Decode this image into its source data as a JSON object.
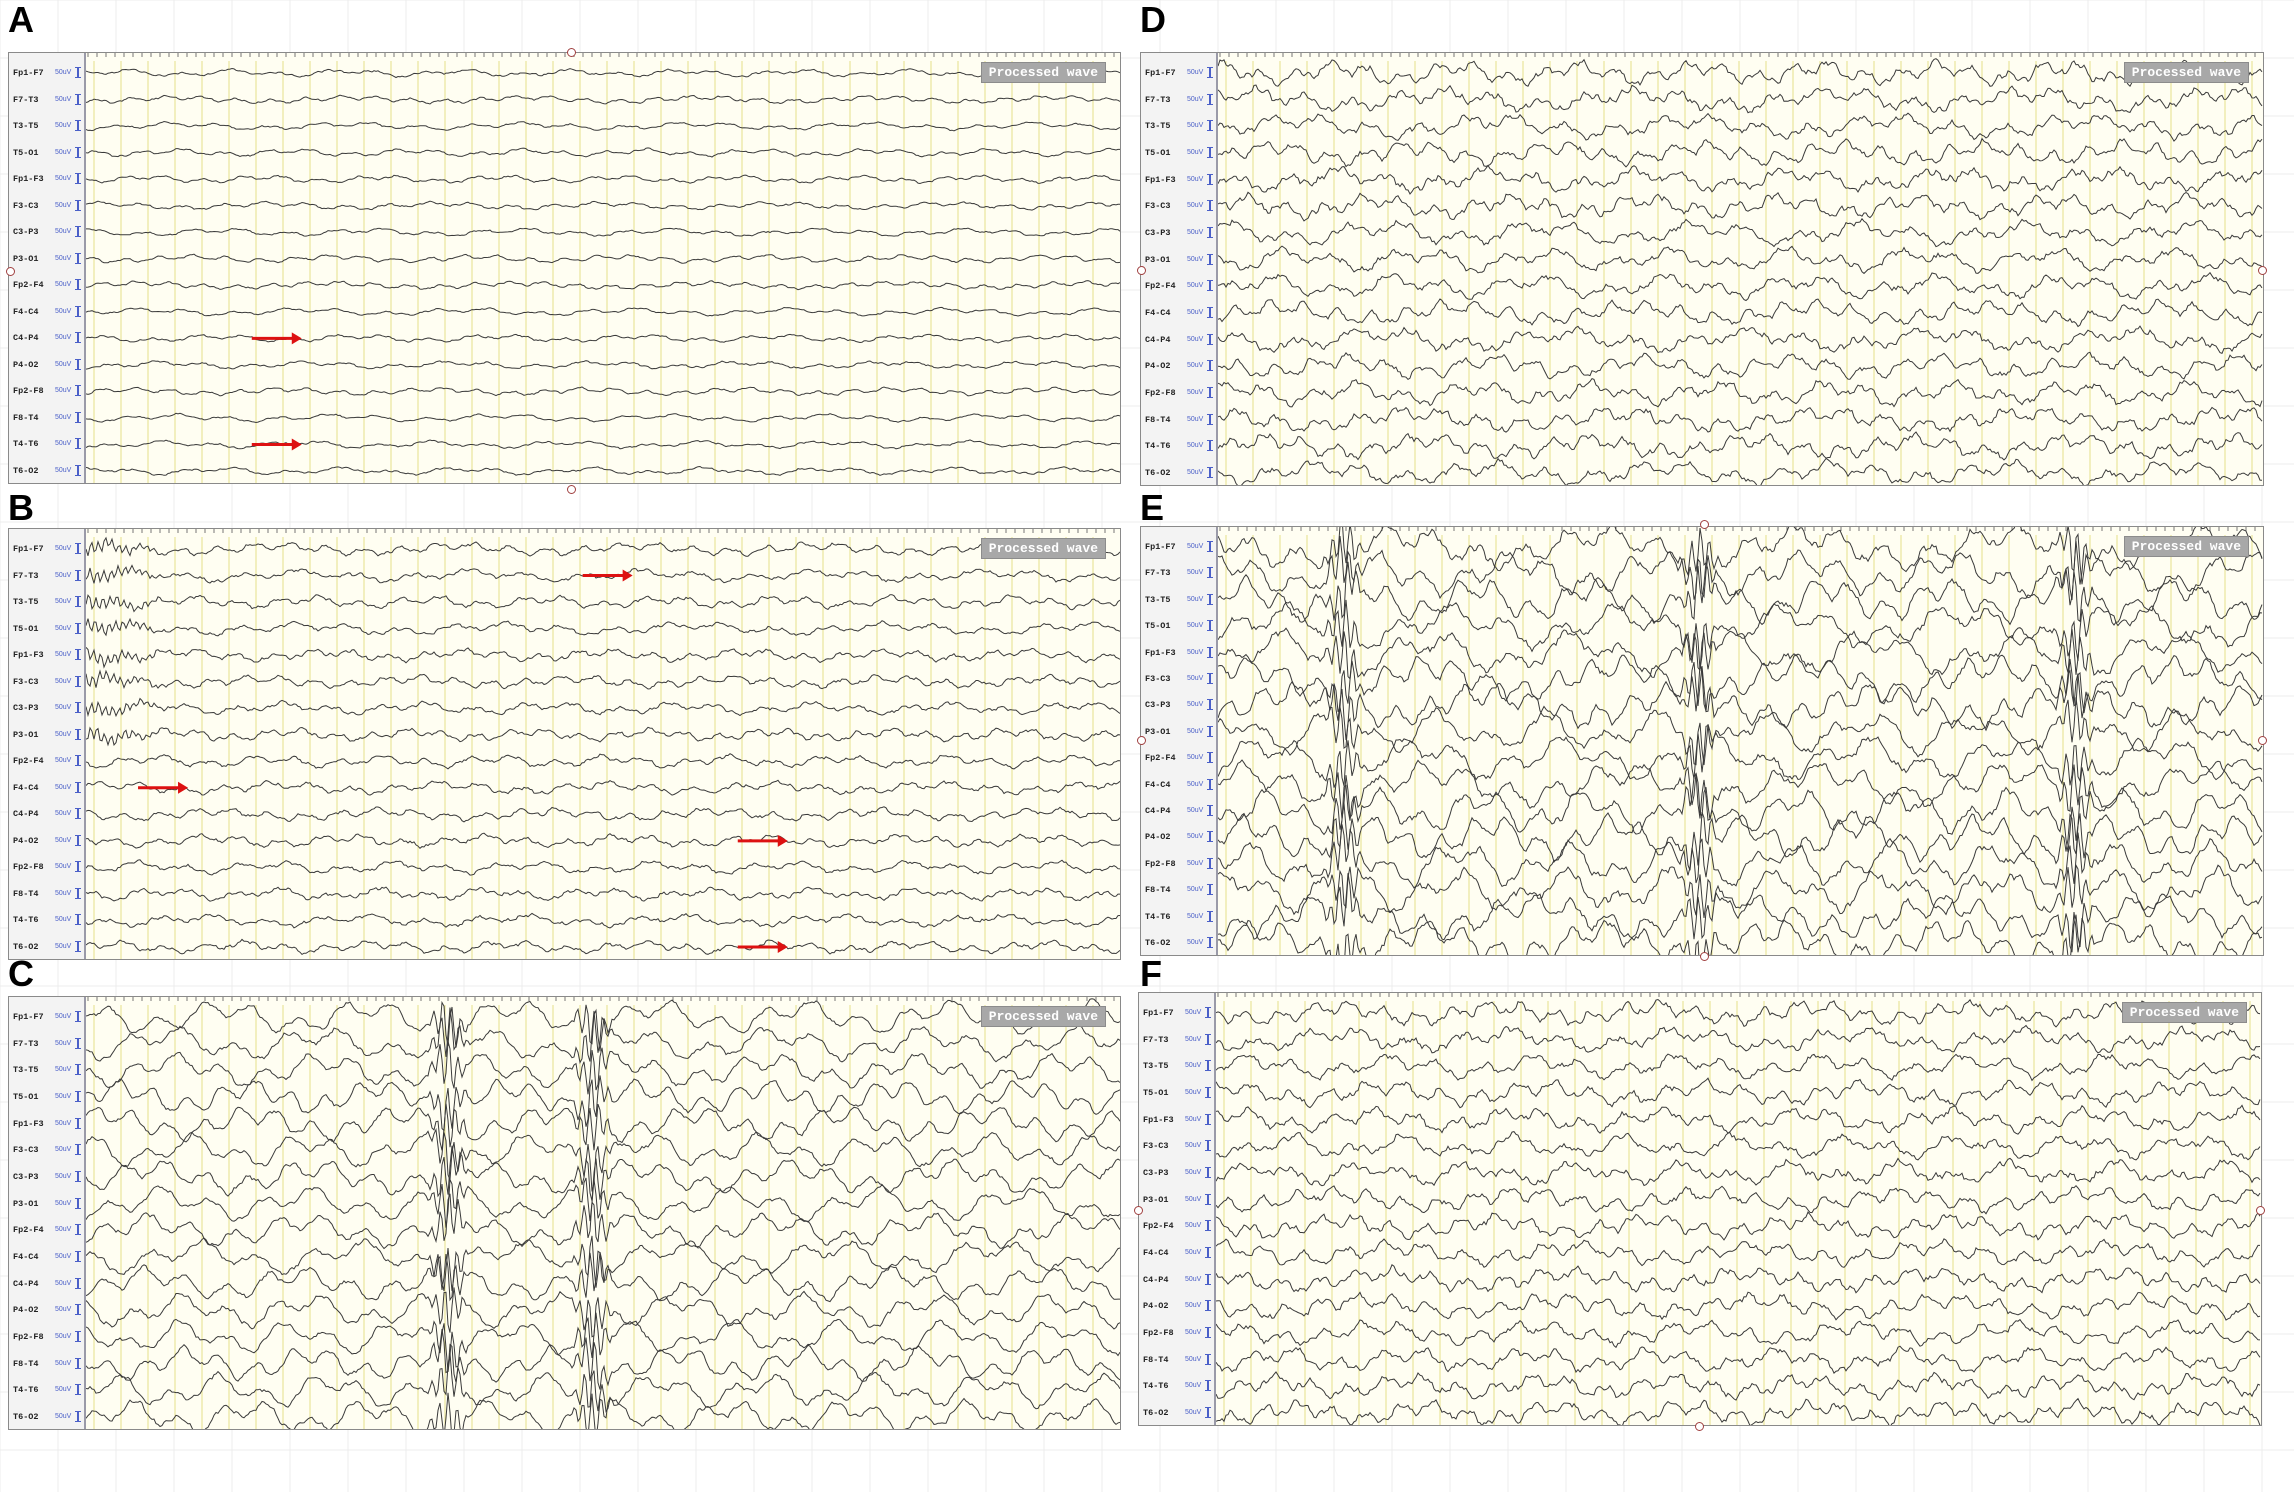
{
  "figure": {
    "channels": [
      {
        "name": "Fp1-F7",
        "scale": "50uV"
      },
      {
        "name": "F7-T3",
        "scale": "50uV"
      },
      {
        "name": "T3-T5",
        "scale": "50uV"
      },
      {
        "name": "T5-O1",
        "scale": "50uV"
      },
      {
        "name": "Fp1-F3",
        "scale": "50uV"
      },
      {
        "name": "F3-C3",
        "scale": "50uV"
      },
      {
        "name": "C3-P3",
        "scale": "50uV"
      },
      {
        "name": "P3-O1",
        "scale": "50uV"
      },
      {
        "name": "Fp2-F4",
        "scale": "50uV"
      },
      {
        "name": "F4-C4",
        "scale": "50uV"
      },
      {
        "name": "C4-P4",
        "scale": "50uV"
      },
      {
        "name": "P4-O2",
        "scale": "50uV"
      },
      {
        "name": "Fp2-F8",
        "scale": "50uV"
      },
      {
        "name": "F8-T4",
        "scale": "50uV"
      },
      {
        "name": "T4-T6",
        "scale": "50uV"
      },
      {
        "name": "T6-O2",
        "scale": "50uV"
      }
    ],
    "colors": {
      "trace": "#3a3a3a",
      "background": "#fffef2",
      "second_lines": "#e6e08a",
      "grid": "#ececec",
      "arrow": "#dd1111",
      "scale_text": "#4a5fc8",
      "marker": "#a04040"
    },
    "panels": [
      {
        "letter": "A",
        "badge": "Processed wave",
        "activity": "low",
        "arrows": [
          {
            "channel": 10
          },
          {
            "channel": 14
          }
        ]
      },
      {
        "letter": "B",
        "badge": "Processed wave",
        "activity": "medium",
        "arrows": [
          {
            "channel": 1
          },
          {
            "channel": 9
          },
          {
            "channel": 11
          },
          {
            "channel": 15
          }
        ]
      },
      {
        "letter": "C",
        "badge": "Processed wave",
        "activity": "high",
        "arrows": []
      },
      {
        "letter": "D",
        "badge": "Processed wave",
        "activity": "mediumhigh",
        "arrows": []
      },
      {
        "letter": "E",
        "badge": "Processed wave",
        "activity": "veryhigh",
        "arrows": []
      },
      {
        "letter": "F",
        "badge": "Processed wave",
        "activity": "mediumhigh",
        "arrows": []
      }
    ]
  }
}
